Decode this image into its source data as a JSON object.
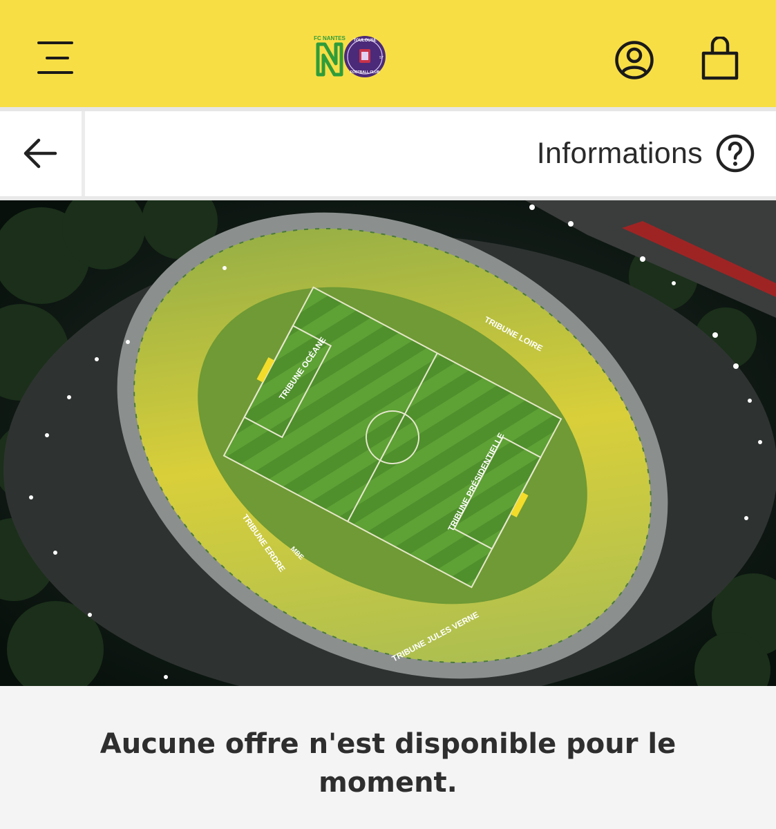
{
  "header": {
    "menu_icon": "hamburger-menu-icon",
    "logos": {
      "home_club": "FC NANTES",
      "away_club": "TOULOUSE FOOTBALL CLUB",
      "away_club_number": "57"
    },
    "account_icon": "user-circle-icon",
    "bag_icon": "shopping-bag-icon",
    "background_color": "#f8de45"
  },
  "navbar": {
    "back_icon": "arrow-left-icon",
    "info_label": "Informations",
    "info_icon": "question-circle-icon"
  },
  "stadium": {
    "stands": {
      "loire": "TRIBUNE LOIRE",
      "oceane": "TRIBUNE OCÉANE",
      "erdre": "TRIBUNE ERDRE",
      "presidentielle": "TRIBUNE PRÉSIDENTIELLE",
      "jules_verne": "TRIBUNE JULES VERNE"
    },
    "sponsor_mbe": "MBE"
  },
  "message": {
    "text": "Aucune offre n'est disponible pour le moment."
  }
}
